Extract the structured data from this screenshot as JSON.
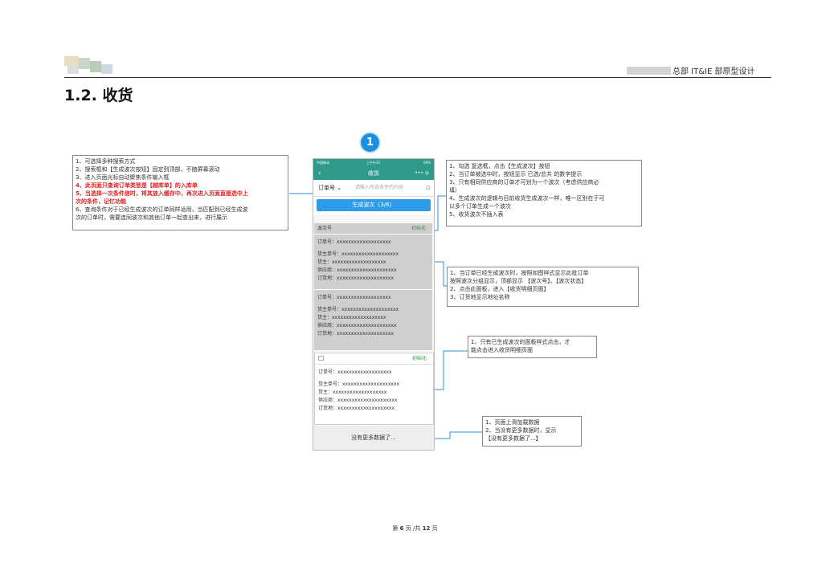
{
  "header": {
    "right_text": "总部 IT&IE 部原型设计"
  },
  "section": {
    "title": "1.2. 收货"
  },
  "badge": {
    "number": "1"
  },
  "notes": {
    "left": {
      "lines": [
        {
          "text": "1、可选择多种搜索方式",
          "red": false
        },
        {
          "text": "2、搜索框和【生成波次按钮】固定到顶部，不随屏幕滚动",
          "red": false
        },
        {
          "text": "3、进入页面光标自动聚焦条件输入框",
          "red": false
        },
        {
          "text": "4、此页面只查询订单类型是【越库单】的入库单",
          "red": true
        },
        {
          "text": "5、当选择一次条件信时，将其放入缓存中，再次进入页面直接选中上",
          "red": true
        },
        {
          "text": "次的条件，记忆功能",
          "red": true
        },
        {
          "text": "6、查询条件对于已经生成波次的订单同样适用，当匹配到已经生成波",
          "red": false
        },
        {
          "text": "次的订单时，需要连同波次和其他订单一起查出来，进行展示",
          "red": false
        }
      ]
    },
    "right1": {
      "lines": [
        "1、勾选 复选框，点击【生成波次】按钮",
        "2、当订单被选中时，按钮显示  已选/总共   的数字提示",
        "3、只有相同供应商的订单才可划为一个波次（考虑供应商必",
        "填）",
        "4、生成波次的逻辑与目前收货生成波次一样，唯一区别在于可",
        "以多个订单生成一个波次",
        "5、收货波次不插入表"
      ]
    },
    "right2": {
      "lines": [
        "1、当订单已经生成波次时，按照如图样式显示此批订单",
        "按照波次分组显示，顶部显示 【波次号】、【波次状态】",
        "2、点击此面板，进入【收货明细页面】",
        "3、订货地显示地址名称"
      ]
    },
    "right3": {
      "lines": [
        "1、只有已生成波次的面板样式点击，才",
        "能点击进入收货明细页面"
      ]
    },
    "right4": {
      "lines": [
        "1、页面上滑加载数据",
        "2、当没有更多数据时，显示",
        "【没有更多数据了...】"
      ]
    }
  },
  "phone": {
    "status": {
      "carrier": "中国移动",
      "time": "上午9:33",
      "battery": "69%"
    },
    "nav": {
      "back": "‹",
      "title": "收货",
      "icons": "••• ◎"
    },
    "search": {
      "selector": "订单号 ⌄",
      "placeholder": "请输入所选条件的内容",
      "scan": "⊡"
    },
    "generate_button": "生成波次（3/6）",
    "wave_card": {
      "header_left": "波次号",
      "header_right": "初始化",
      "orders": [
        {
          "order_no": "订单号：xxxxxxxxxxxxxxxxxxx",
          "owner_order_no": "货主单号：xxxxxxxxxxxxxxxxxxxx",
          "owner": "货主：xxxxxxxxxxxxxxxxxxx",
          "supplier": "供应商：xxxxxxxxxxxxxxxxxxxxx",
          "order_place": "订货地：xxxxxxxxxxxxxxxxxxxx"
        },
        {
          "order_no": "订单号：xxxxxxxxxxxxxxxxxxx",
          "owner_order_no": "货主单号：xxxxxxxxxxxxxxxxxxxx",
          "owner": "货主：xxxxxxxxxxxxxxxxxxx",
          "supplier": "供应商：xxxxxxxxxxxxxxxxxxxxx",
          "order_place": "订货地：xxxxxxxxxxxxxxxxxxxx"
        }
      ]
    },
    "order_card": {
      "checkbox": "☐",
      "header_right": "初始化",
      "order_no": "订单号：xxxxxxxxxxxxxxxxxxx",
      "owner_order_no": "货主单号：xxxxxxxxxxxxxxxxxxxx",
      "owner": "货主：xxxxxxxxxxxxxxxxxxx",
      "supplier": "供应商：xxxxxxxxxxxxxxxxxxxxx",
      "order_place": "订货地：xxxxxxxxxxxxxxxxxxxx"
    },
    "no_more": "没有更多数据了..."
  },
  "footer": {
    "prefix": "第",
    "page": "6",
    "mid": "页 /共",
    "total": "12",
    "suffix": "页"
  },
  "colors": {
    "accent_blue": "#2e9ce8",
    "nav_teal": "#2f9a8a",
    "highlight_red": "#e02020",
    "status_green": "#2f9a4a"
  }
}
